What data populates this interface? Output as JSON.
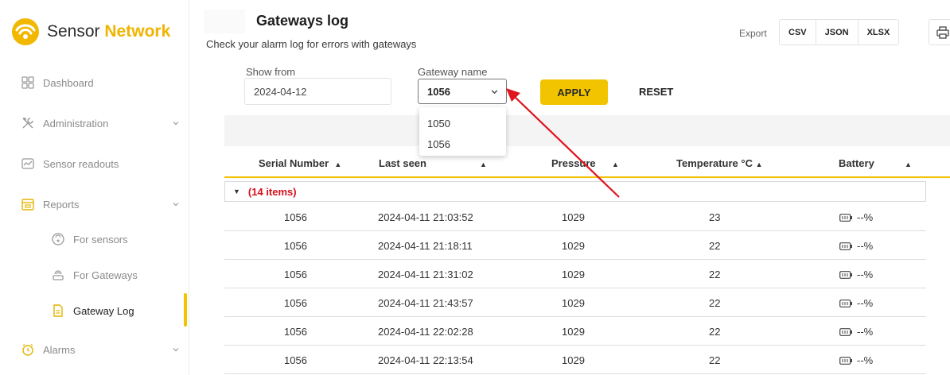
{
  "brand": {
    "name_plain": "Sensor",
    "name_accent": "Network"
  },
  "sidebar": {
    "items": [
      {
        "label": "Dashboard",
        "icon": "grid-icon"
      },
      {
        "label": "Administration",
        "icon": "tools-icon"
      },
      {
        "label": "Sensor readouts",
        "icon": "chart-icon"
      },
      {
        "label": "Reports",
        "icon": "calendar-icon"
      },
      {
        "label": "For sensors",
        "icon": "sensor-icon"
      },
      {
        "label": "For Gateways",
        "icon": "gateway-icon"
      },
      {
        "label": "Gateway Log",
        "icon": "document-icon"
      },
      {
        "label": "Alarms",
        "icon": "alarm-clock-icon"
      }
    ]
  },
  "header": {
    "title": "Gateways log",
    "subtitle": "Check your alarm log for errors with gateways",
    "export_label": "Export",
    "export_buttons": [
      "CSV",
      "JSON",
      "XLSX"
    ]
  },
  "filters": {
    "show_from_label": "Show from",
    "show_from_value": "2024-04-12",
    "gateway_label": "Gateway name",
    "gateway_value": "1056",
    "gateway_options": [
      "1050",
      "1056"
    ],
    "apply_label": "APPLY",
    "reset_label": "RESET"
  },
  "table": {
    "columns": [
      "Serial Number",
      "Last seen",
      "Pressure",
      "Temperature °C",
      "Battery"
    ],
    "group_label": "(14 items)",
    "rows": [
      {
        "serial": "1056",
        "last_seen": "2024-04-11 21:03:52",
        "pressure": "1029",
        "temperature": "23",
        "battery": "--%"
      },
      {
        "serial": "1056",
        "last_seen": "2024-04-11 21:18:11",
        "pressure": "1029",
        "temperature": "22",
        "battery": "--%"
      },
      {
        "serial": "1056",
        "last_seen": "2024-04-11 21:31:02",
        "pressure": "1029",
        "temperature": "22",
        "battery": "--%"
      },
      {
        "serial": "1056",
        "last_seen": "2024-04-11 21:43:57",
        "pressure": "1029",
        "temperature": "22",
        "battery": "--%"
      },
      {
        "serial": "1056",
        "last_seen": "2024-04-11 22:02:28",
        "pressure": "1029",
        "temperature": "22",
        "battery": "--%"
      },
      {
        "serial": "1056",
        "last_seen": "2024-04-11 22:13:54",
        "pressure": "1029",
        "temperature": "22",
        "battery": "--%"
      }
    ]
  },
  "colors": {
    "accent": "#f0c400",
    "brand_accent": "#f0b400",
    "group_count": "#d8101a",
    "annotation_arrow": "#e0141e"
  }
}
